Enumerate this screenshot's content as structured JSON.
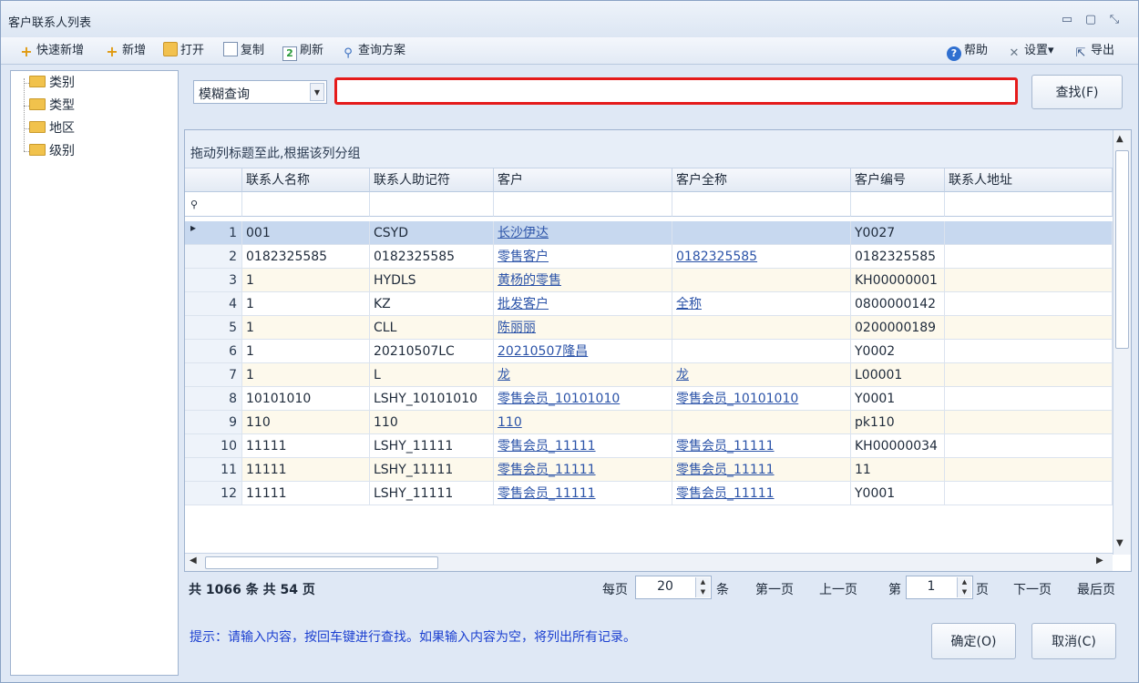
{
  "window": {
    "title": "客户联系人列表",
    "btn_min": "▭",
    "btn_max": "▢",
    "btn_close": "⤡"
  },
  "toolbar": {
    "quick_add": "快速新增",
    "add": "新增",
    "open": "打开",
    "copy": "复制",
    "refresh": "刷新",
    "query_plan": "查询方案",
    "help": "帮助",
    "settings": "设置▾",
    "export": "导出"
  },
  "tree": {
    "items": [
      "类别",
      "类型",
      "地区",
      "级别"
    ]
  },
  "search": {
    "mode": "模糊查询",
    "placeholder": "",
    "find_label": "查找(F)"
  },
  "grid": {
    "group_hint": "拖动列标题至此,根据该列分组",
    "columns": [
      "联系人名称",
      "联系人助记符",
      "客户",
      "客户全称",
      "客户编号",
      "联系人地址"
    ],
    "filter_icon": "⚲",
    "rows": [
      {
        "n": "1",
        "name": "001",
        "mnemonic": "CSYD",
        "customer": "长沙伊达",
        "fullname": "",
        "code": "Y0027",
        "address": ""
      },
      {
        "n": "2",
        "name": "0182325585",
        "mnemonic": "0182325585",
        "customer": "零售客户",
        "fullname": "0182325585",
        "code": "0182325585",
        "address": ""
      },
      {
        "n": "3",
        "name": "1",
        "mnemonic": "HYDLS",
        "customer": "黄杨的零售",
        "fullname": "",
        "code": "KH00000001",
        "address": ""
      },
      {
        "n": "4",
        "name": "1",
        "mnemonic": "KZ",
        "customer": "批发客户",
        "fullname": "全称",
        "code": "0800000142",
        "address": ""
      },
      {
        "n": "5",
        "name": "1",
        "mnemonic": "CLL",
        "customer": "陈丽丽",
        "fullname": "",
        "code": "0200000189",
        "address": ""
      },
      {
        "n": "6",
        "name": "1",
        "mnemonic": "20210507LC",
        "customer": "20210507隆昌",
        "fullname": "",
        "code": "Y0002",
        "address": ""
      },
      {
        "n": "7",
        "name": "1",
        "mnemonic": "L",
        "customer": "龙",
        "fullname": "龙",
        "code": "L00001",
        "address": ""
      },
      {
        "n": "8",
        "name": "10101010",
        "mnemonic": "LSHY_10101010",
        "customer": "零售会员_10101010",
        "fullname": "零售会员_10101010",
        "code": "Y0001",
        "address": ""
      },
      {
        "n": "9",
        "name": "110",
        "mnemonic": "110",
        "customer": "110",
        "fullname": "",
        "code": "pk110",
        "address": ""
      },
      {
        "n": "10",
        "name": "11111",
        "mnemonic": "LSHY_11111",
        "customer": "零售会员_11111",
        "fullname": "零售会员_11111",
        "code": "KH00000034",
        "address": ""
      },
      {
        "n": "11",
        "name": "11111",
        "mnemonic": "LSHY_11111",
        "customer": "零售会员_11111",
        "fullname": "零售会员_11111",
        "code": "11",
        "address": ""
      },
      {
        "n": "12",
        "name": "11111",
        "mnemonic": "LSHY_11111",
        "customer": "零售会员_11111",
        "fullname": "零售会员_11111",
        "code": "Y0001",
        "address": ""
      }
    ]
  },
  "pager": {
    "summary": "共 1066 条  共 54 页",
    "per_page_label": "每页",
    "per_page_value": "20",
    "per_page_unit": "条",
    "first": "第一页",
    "prev": "上一页",
    "page_label": "第",
    "page_value": "1",
    "page_unit": "页",
    "next": "下一页",
    "last": "最后页"
  },
  "hint": "提示：请输入内容，按回车键进行查找。如果输入内容为空，将列出所有记录。",
  "actions": {
    "ok": "确定(O)",
    "cancel": "取消(C)"
  }
}
